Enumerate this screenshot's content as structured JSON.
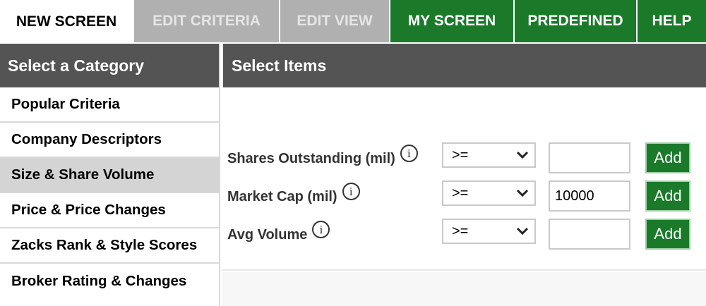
{
  "tabs": {
    "new_screen": "NEW SCREEN",
    "edit_criteria": "EDIT CRITERIA",
    "edit_view": "EDIT VIEW",
    "my_screen": "MY SCREEN",
    "predefined": "PREDEFINED",
    "help": "HELP"
  },
  "category_panel": {
    "title": "Select a Category",
    "items": [
      {
        "label": "Popular Criteria"
      },
      {
        "label": "Company Descriptors"
      },
      {
        "label": "Size & Share Volume"
      },
      {
        "label": "Price & Price Changes"
      },
      {
        "label": "Zacks Rank & Style Scores"
      },
      {
        "label": "Broker Rating & Changes"
      }
    ],
    "selected": "Size & Share Volume"
  },
  "items_panel": {
    "title": "Select Items",
    "rows": [
      {
        "label": "Shares Outstanding (mil)",
        "operator": ">=",
        "value": "",
        "add_label": "Add"
      },
      {
        "label": "Market Cap (mil)",
        "operator": ">=",
        "value": "10000",
        "add_label": "Add"
      },
      {
        "label": "Avg Volume",
        "operator": ">=",
        "value": "",
        "add_label": "Add"
      }
    ]
  },
  "icons": {
    "info": "i",
    "dropdown": "chevron-down-icon"
  },
  "colors": {
    "accent_green": "#1a7a2a",
    "disabled_tab": "#b0b0b0",
    "header_dark": "#545454",
    "selected_category": "#d4d4d4"
  }
}
